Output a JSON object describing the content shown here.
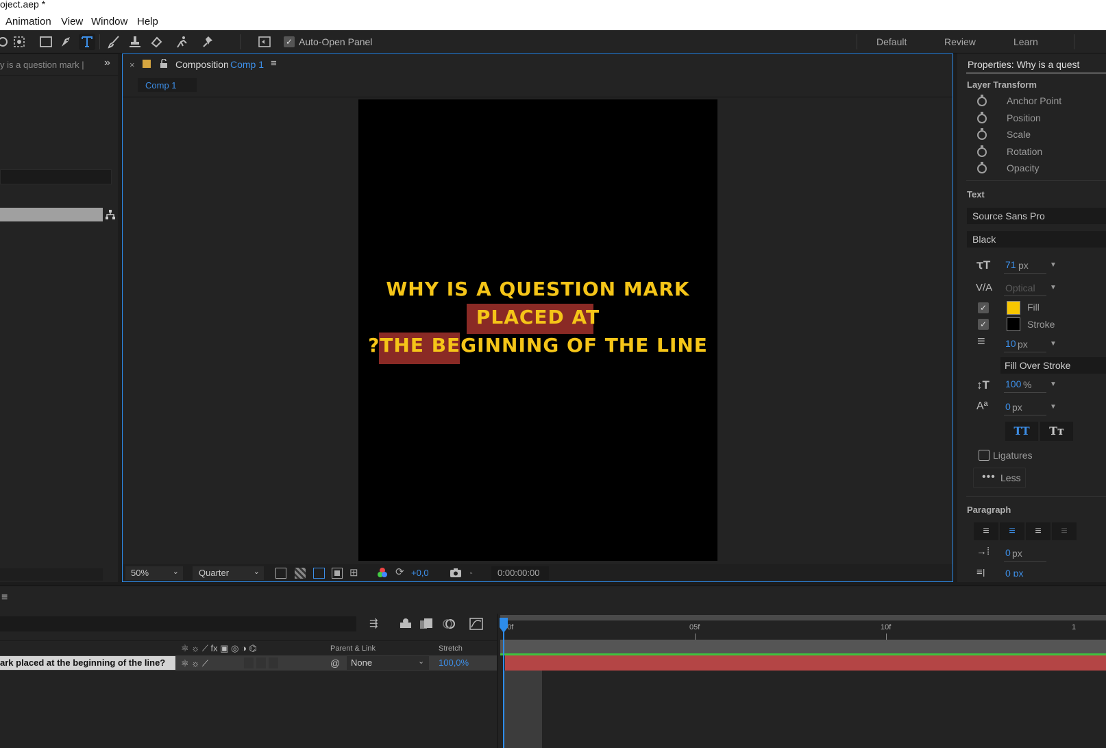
{
  "window": {
    "title": "oject.aep *"
  },
  "menu": [
    "Animation",
    "View",
    "Window",
    "Help"
  ],
  "toolbar": {
    "auto_open_label": "Auto-Open Panel",
    "workspaces": [
      "Default",
      "Review",
      "Learn"
    ]
  },
  "project_panel": {
    "tab_label": "y is a question mark |"
  },
  "composition": {
    "tab_prefix": "Composition",
    "tab_name": "Comp 1",
    "flow_chip": "Comp 1",
    "canvas_lines": [
      "WHY IS A QUESTION MARK",
      "PLACED AT",
      "?THE BEGINNING OF THE LINE"
    ],
    "zoom": "50%",
    "resolution": "Quarter",
    "exposure": "+0,0",
    "timecode": "0:00:00:00"
  },
  "properties": {
    "title": "Properties: Why is a quest",
    "layer_transform_label": "Layer Transform",
    "transform_items": [
      "Anchor Point",
      "Position",
      "Scale",
      "Rotation",
      "Opacity"
    ],
    "text_label": "Text",
    "font_family": "Source Sans Pro",
    "font_style": "Black",
    "font_size": "71",
    "font_size_unit": "px",
    "kerning": "Optical",
    "fill_label": "Fill",
    "stroke_label": "Stroke",
    "fill_color": "#f7c600",
    "stroke_color": "#000000",
    "stroke_width": "10",
    "stroke_width_unit": "px",
    "fill_over_stroke": "Fill Over Stroke",
    "leading": "100",
    "leading_unit": "%",
    "baseline_shift": "0",
    "baseline_unit": "px",
    "caps_all": "TT",
    "caps_small": "Tт",
    "ligatures_label": "Ligatures",
    "less_label": "Less",
    "paragraph_label": "Paragraph",
    "indent_value": "0",
    "indent_unit": "px",
    "indent2_text": "0 px"
  },
  "timeline": {
    "col_parent": "Parent & Link",
    "col_stretch": "Stretch",
    "layer_name": "ark placed at the beginning of the line?",
    "parent_value": "None",
    "stretch_value": "100,0%",
    "ruler_marks": [
      "00f",
      "05f",
      "10f",
      "1"
    ]
  },
  "colors": {
    "accent": "#2d8ceb",
    "text_yellow": "#f5c518",
    "highlight": "#8a2a25",
    "layer_bar": "#b44545"
  }
}
